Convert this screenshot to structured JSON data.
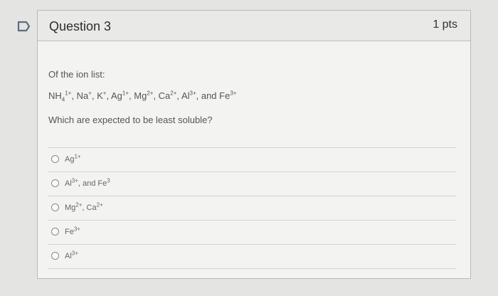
{
  "question": {
    "title": "Question 3",
    "points": "1 pts",
    "intro": "Of the ion list:",
    "ions": [
      {
        "sym": "NH",
        "sub": "4",
        "sup": "1+",
        "sep": ", "
      },
      {
        "sym": "Na",
        "sub": "",
        "sup": "+",
        "sep": ", "
      },
      {
        "sym": "K",
        "sub": "",
        "sup": "+",
        "sep": ", "
      },
      {
        "sym": "Ag",
        "sub": "",
        "sup": "1+",
        "sep": ", "
      },
      {
        "sym": "Mg",
        "sub": "",
        "sup": "2+",
        "sep": ", "
      },
      {
        "sym": "Ca",
        "sub": "",
        "sup": "2+",
        "sep": ", "
      },
      {
        "sym": "Al",
        "sub": "",
        "sup": "3+",
        "sep": ", and "
      },
      {
        "sym": "Fe",
        "sub": "",
        "sup": "3+",
        "sep": ""
      }
    ],
    "prompt": "Which are expected to be least soluble?"
  },
  "answers": [
    {
      "parts": [
        {
          "t": "Ag",
          "sup": "1+"
        }
      ]
    },
    {
      "parts": [
        {
          "t": "Al",
          "sup": "3+"
        },
        {
          "t": ", and Fe",
          "sup": "3"
        }
      ]
    },
    {
      "parts": [
        {
          "t": "Mg",
          "sup": "2+"
        },
        {
          "t": ", Ca",
          "sup": "2+"
        }
      ]
    },
    {
      "parts": [
        {
          "t": "Fe",
          "sup": "3+"
        }
      ]
    },
    {
      "parts": [
        {
          "t": "Al",
          "sup": "3+"
        }
      ]
    }
  ],
  "colors": {
    "flag": "#5f6b84",
    "border": "#b9b9b7"
  },
  "icons": {
    "flag": "flag-icon"
  }
}
